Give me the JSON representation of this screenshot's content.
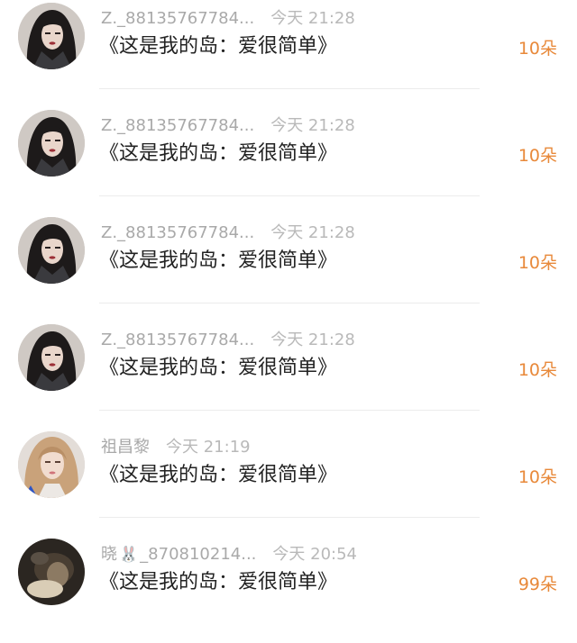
{
  "gifts": [
    {
      "user": "Z._88135767784...",
      "time": "今天 21:28",
      "title": "《这是我的岛：爱很简单》",
      "count": "10朵",
      "avatar_icon": "woman-dark-hair-avatar"
    },
    {
      "user": "Z._88135767784...",
      "time": "今天 21:28",
      "title": "《这是我的岛：爱很简单》",
      "count": "10朵",
      "avatar_icon": "woman-dark-hair-avatar"
    },
    {
      "user": "Z._88135767784...",
      "time": "今天 21:28",
      "title": "《这是我的岛：爱很简单》",
      "count": "10朵",
      "avatar_icon": "woman-dark-hair-avatar"
    },
    {
      "user": "Z._88135767784...",
      "time": "今天 21:28",
      "title": "《这是我的岛：爱很简单》",
      "count": "10朵",
      "avatar_icon": "woman-dark-hair-avatar"
    },
    {
      "user": "祖昌黎",
      "time": "今天 21:19",
      "title": "《这是我的岛：爱很简单》",
      "count": "10朵",
      "avatar_icon": "woman-blonde-avatar"
    },
    {
      "user_prefix": "晓",
      "user_emoji": "🐰",
      "user_suffix": "_870810214...",
      "time": "今天 20:54",
      "title": "《这是我的岛：爱很简单》",
      "count": "99朵",
      "avatar_icon": "dark-photo-avatar"
    }
  ],
  "colors": {
    "count": "#e8893a",
    "meta": "#a9a9a9",
    "title": "#222222",
    "divider": "#ececec"
  }
}
